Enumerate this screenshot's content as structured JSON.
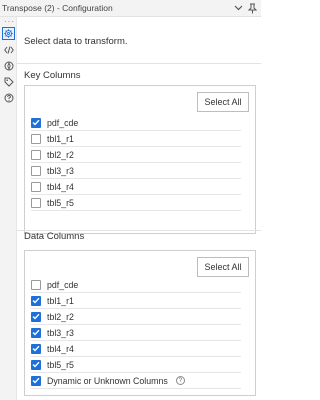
{
  "window": {
    "title": "Transpose (2) - Configuration",
    "collapse_icon": "chevron-down-icon",
    "pin_icon": "pin-icon"
  },
  "sidebar": {
    "items": [
      {
        "name": "configuration",
        "icon": "gear-icon",
        "active": true
      },
      {
        "name": "xml",
        "icon": "code-icon",
        "active": false
      },
      {
        "name": "annotation",
        "icon": "compass-icon",
        "active": false
      },
      {
        "name": "tags",
        "icon": "tag-icon",
        "active": false
      },
      {
        "name": "help",
        "icon": "help-icon",
        "active": false
      }
    ],
    "accent_color": "#1e6fd9"
  },
  "main": {
    "intro": "Select data to transform.",
    "key_columns": {
      "title": "Key Columns",
      "select_all_label": "Select All",
      "items": [
        {
          "label": "pdf_cde",
          "checked": true
        },
        {
          "label": "tbl1_r1",
          "checked": false
        },
        {
          "label": "tbl2_r2",
          "checked": false
        },
        {
          "label": "tbl3_r3",
          "checked": false
        },
        {
          "label": "tbl4_r4",
          "checked": false
        },
        {
          "label": "tbl5_r5",
          "checked": false
        }
      ]
    },
    "data_columns": {
      "title": "Data Columns",
      "select_all_label": "Select All",
      "items": [
        {
          "label": "pdf_cde",
          "checked": false
        },
        {
          "label": "tbl1_r1",
          "checked": true
        },
        {
          "label": "tbl2_r2",
          "checked": true
        },
        {
          "label": "tbl3_r3",
          "checked": true
        },
        {
          "label": "tbl4_r4",
          "checked": true
        },
        {
          "label": "tbl5_r5",
          "checked": true
        },
        {
          "label": "Dynamic or Unknown Columns",
          "checked": true,
          "help": "?"
        }
      ]
    }
  }
}
